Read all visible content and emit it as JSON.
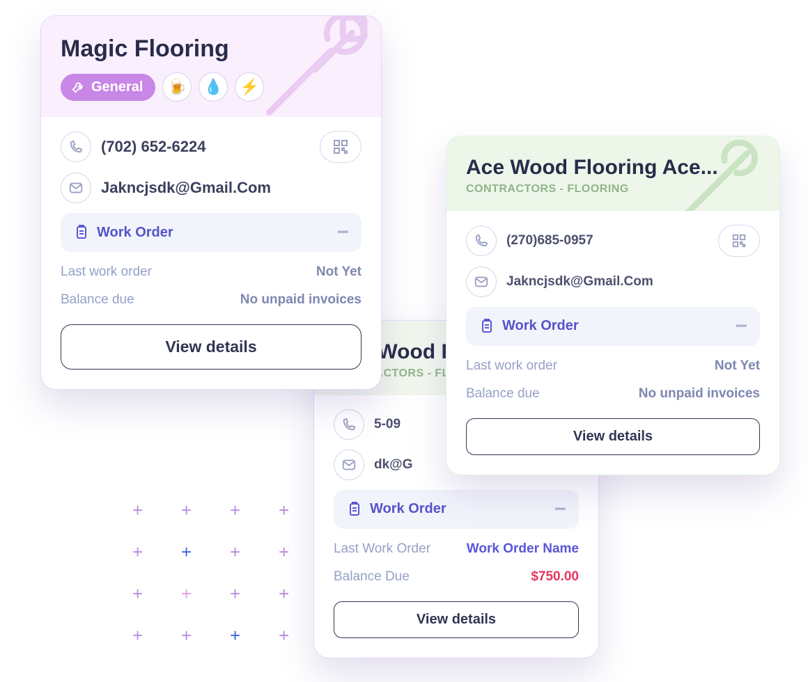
{
  "plus_colors": [
    "#b98de0",
    "#b98de0",
    "#b98de0",
    "#b98de0",
    "#b98de0",
    "#3f63e8",
    "#b98de0",
    "#b98de0",
    "#b98de0",
    "#e59ae6",
    "#b98de0",
    "#b98de0",
    "#b98de0",
    "#b98de0",
    "#3f63e8",
    "#b98de0"
  ],
  "cardA": {
    "name": "Magic Flooring",
    "primary_tag": "General",
    "chips": [
      "beer",
      "water",
      "bolt"
    ],
    "phone": "(702) 652-6224",
    "email": "Jakncjsdk@Gmail.Com",
    "wo_label": "Work Order",
    "last_k": "Last work order",
    "last_v": "Not Yet",
    "bal_k": "Balance due",
    "bal_v": "No unpaid invoices",
    "view": "View details"
  },
  "cardB": {
    "name": "Ace Wood Flooring Ace...",
    "subtitle": "CONTRACTORS - FLOORING",
    "phone_partial": "5-09",
    "email_partial": "dk@G",
    "wo_label": "Work Order",
    "last_k": "Last Work Order",
    "last_v": "Work Order Name",
    "bal_k": "Balance Due",
    "bal_v": "$750.00",
    "view": "View details"
  },
  "cardC": {
    "name": "Ace Wood Flooring Ace...",
    "subtitle": "CONTRACTORS - FLOORING",
    "phone": "(270)685-0957",
    "email": "Jakncjsdk@Gmail.Com",
    "wo_label": "Work Order",
    "last_k": "Last work order",
    "last_v": "Not Yet",
    "bal_k": "Balance due",
    "bal_v": "No unpaid invoices",
    "view": "View details"
  }
}
